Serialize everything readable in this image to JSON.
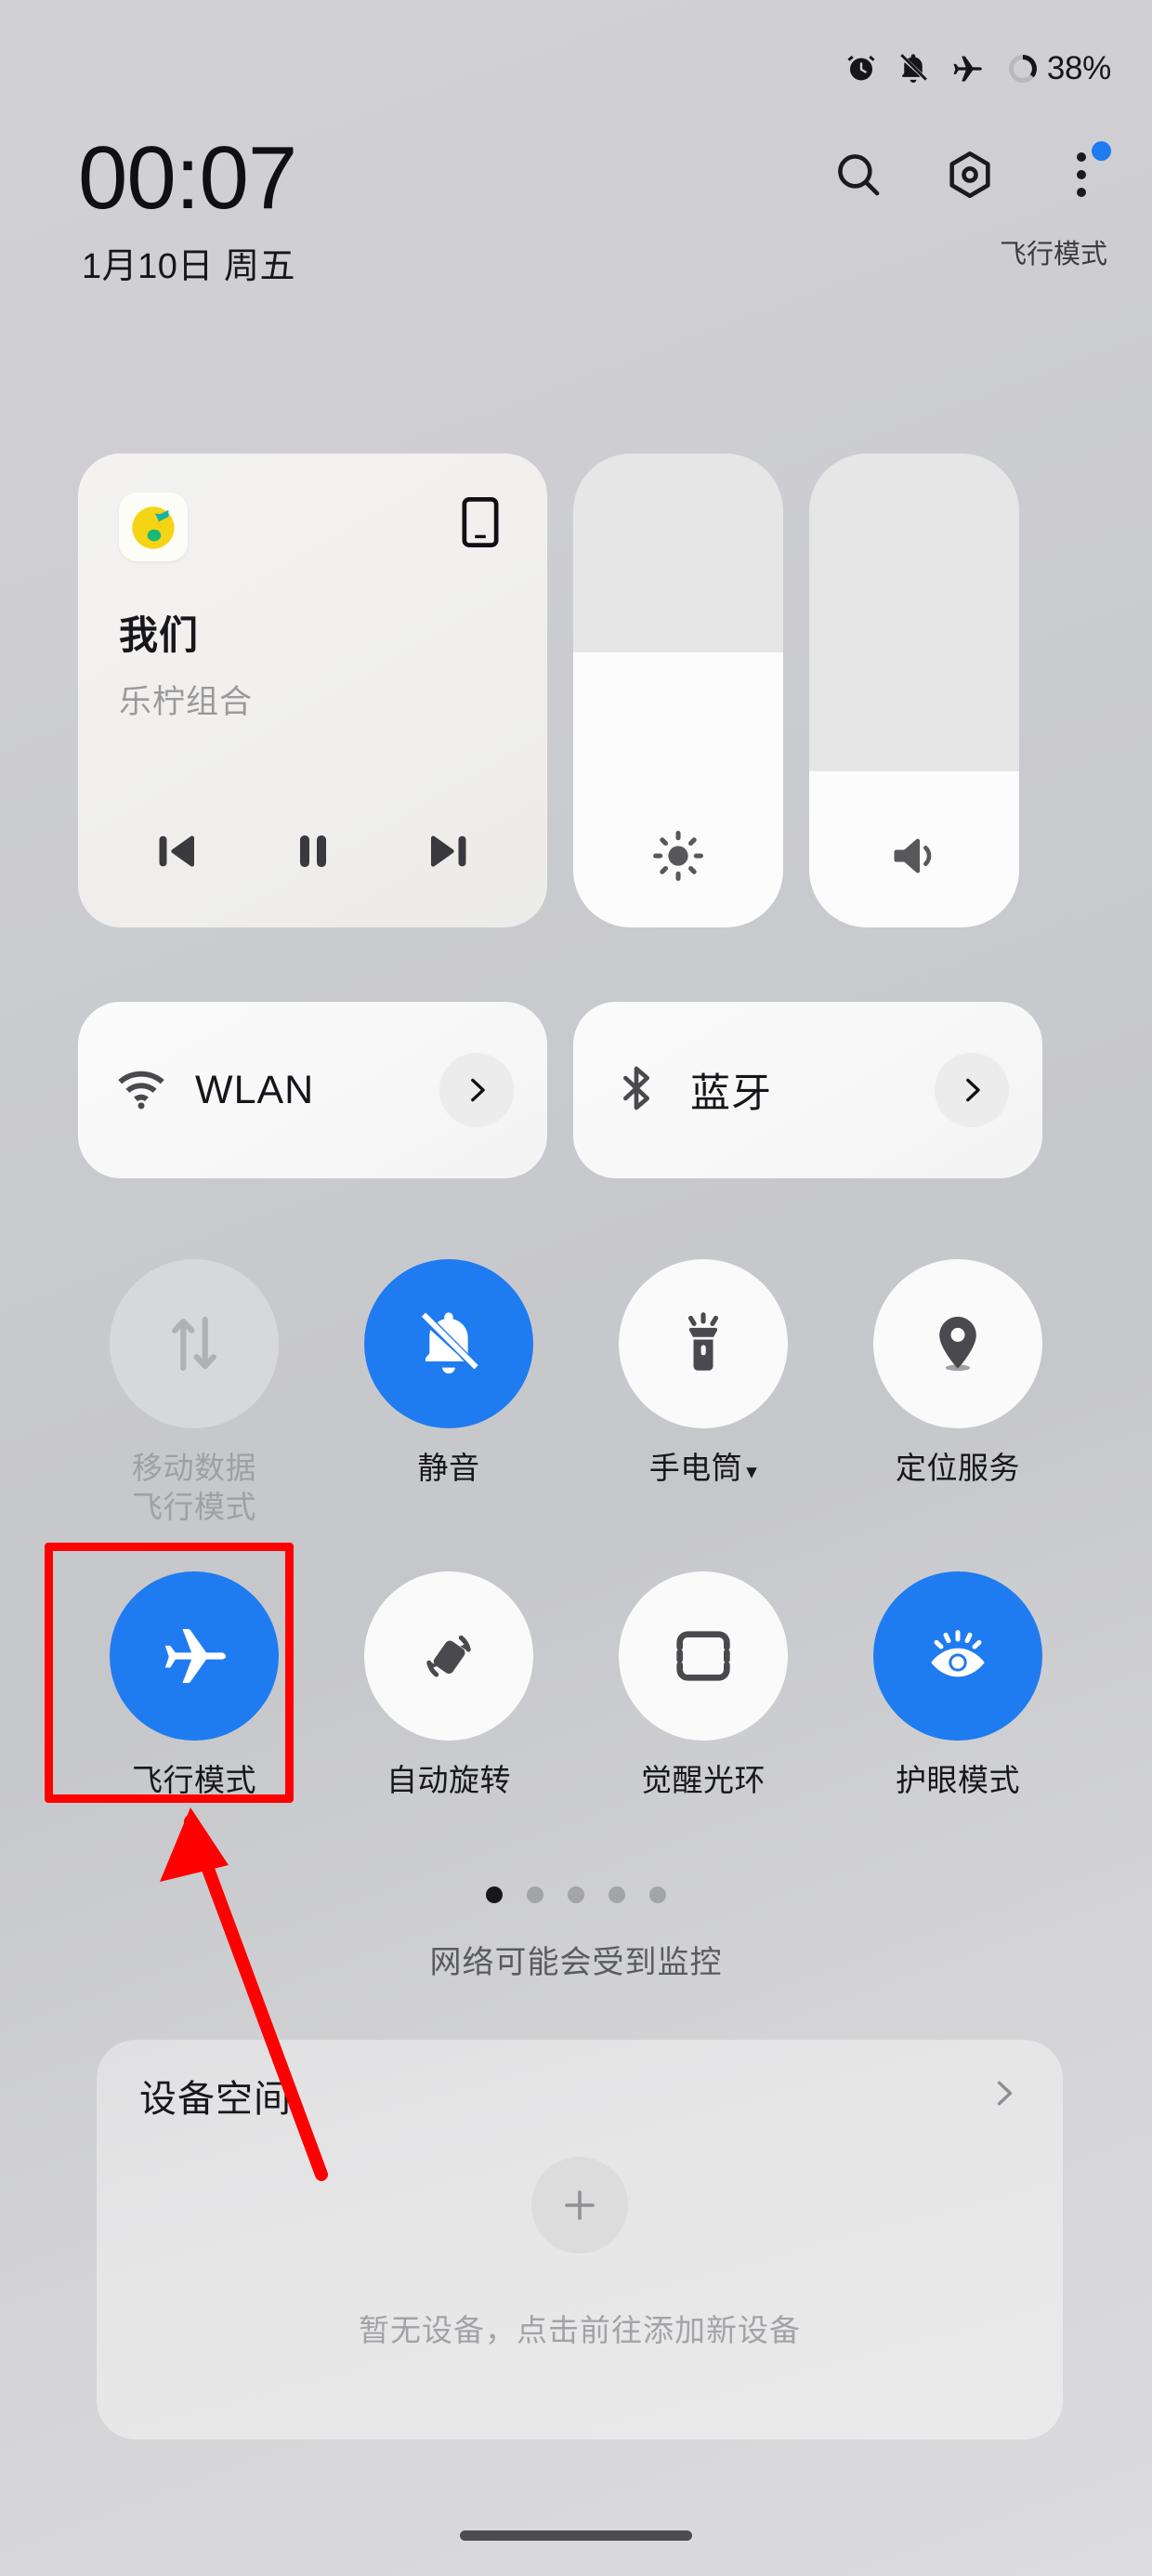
{
  "statusbar": {
    "icons": [
      "alarm-icon",
      "bell-muted-icon",
      "airplane-icon"
    ],
    "battery_percent": "38%",
    "battery_level": 38
  },
  "header": {
    "time": "00:07",
    "date": "1月10日 周五",
    "mode_label": "飞行模式",
    "icons": [
      "search-icon",
      "settings-hex-icon",
      "overflow-menu-icon"
    ],
    "badge_color": "#1f7bf0"
  },
  "music": {
    "app_icon": "qq-music-icon",
    "cast_icon": "phone-cast-icon",
    "title": "我们",
    "artist": "乐柠组合",
    "controls": [
      "previous-track-icon",
      "pause-icon",
      "next-track-icon"
    ]
  },
  "sliders": [
    {
      "name": "brightness",
      "icon": "brightness-icon",
      "value": 58
    },
    {
      "name": "volume",
      "icon": "volume-icon",
      "value": 33
    }
  ],
  "connectivity": [
    {
      "label": "WLAN",
      "icon": "wifi-icon"
    },
    {
      "label": "蓝牙",
      "icon": "bluetooth-icon"
    }
  ],
  "toggles": [
    {
      "label": "移动数据",
      "label2": "飞行模式",
      "icon": "mobile-data-icon",
      "state": "disabled"
    },
    {
      "label": "静音",
      "icon": "bell-muted-icon",
      "state": "on"
    },
    {
      "label": "手电筒",
      "caret": "▾",
      "icon": "flashlight-icon",
      "state": "off"
    },
    {
      "label": "定位服务",
      "icon": "location-pin-icon",
      "state": "off"
    },
    {
      "label": "飞行模式",
      "icon": "airplane-icon",
      "state": "on"
    },
    {
      "label": "自动旋转",
      "icon": "auto-rotate-icon",
      "state": "off"
    },
    {
      "label": "觉醒光环",
      "icon": "wake-halo-icon",
      "state": "off"
    },
    {
      "label": "护眼模式",
      "icon": "eye-comfort-icon",
      "state": "on"
    }
  ],
  "pager": {
    "count": 5,
    "active_index": 0
  },
  "notice": "网络可能会受到监控",
  "device_space": {
    "title": "设备空间",
    "chevron": "chevron-right-icon",
    "add_icon": "plus-icon",
    "empty_text": "暂无设备，点击前往添加新设备"
  },
  "annotations": {
    "highlight_color": "#fe0000",
    "target": "飞行模式"
  },
  "colors": {
    "accent": "#1f7bf0",
    "tile_off": "#fafafa",
    "tile_dim": "#d7d8dc"
  }
}
